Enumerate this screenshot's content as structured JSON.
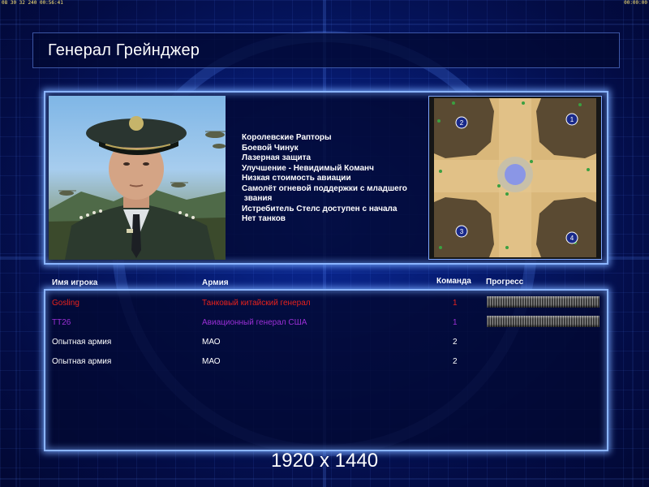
{
  "top_bar": {
    "left_text": "08 30 32 240 00:56:41",
    "right_text": "00:00:00"
  },
  "header": {
    "title": "Генерал Грейнджер"
  },
  "general": {
    "portrait_icon": "general-portrait",
    "bonuses": [
      "Королевские Рапторы",
      "Боевой Чинук",
      "Лазерная защита",
      "Улучшение - Невидимый Команч",
      "Низкая стоимость авиации",
      "Самолёт огневой поддержки с младшего",
      " звания",
      "Истребитель Стелс доступен с начала",
      "Нет танков"
    ]
  },
  "minimap": {
    "start_positions": [
      "1",
      "2",
      "3",
      "4"
    ]
  },
  "players_table": {
    "headers": {
      "name": "Имя игрока",
      "army": "Армия",
      "team": "Команда",
      "progress": "Прогресс"
    },
    "rows": [
      {
        "name": "Gosling",
        "army": "Танковый китайский генерал",
        "team": "1",
        "color": "#e8221c",
        "has_progress": true
      },
      {
        "name": "TT26",
        "army": "Авиационный генерал США",
        "team": "1",
        "color": "#9b2fd6",
        "has_progress": true
      },
      {
        "name": "Опытная армия",
        "army": "МАО",
        "team": "2",
        "color": "#ffffff",
        "has_progress": false
      },
      {
        "name": "Опытная армия",
        "army": "МАО",
        "team": "2",
        "color": "#ffffff",
        "has_progress": false
      }
    ]
  },
  "overlay": {
    "resolution_label": "1920 x 1440"
  },
  "colors": {
    "background": "#061a6e",
    "frame_glow": "#8ab4ff",
    "sand": "#e0be80"
  }
}
